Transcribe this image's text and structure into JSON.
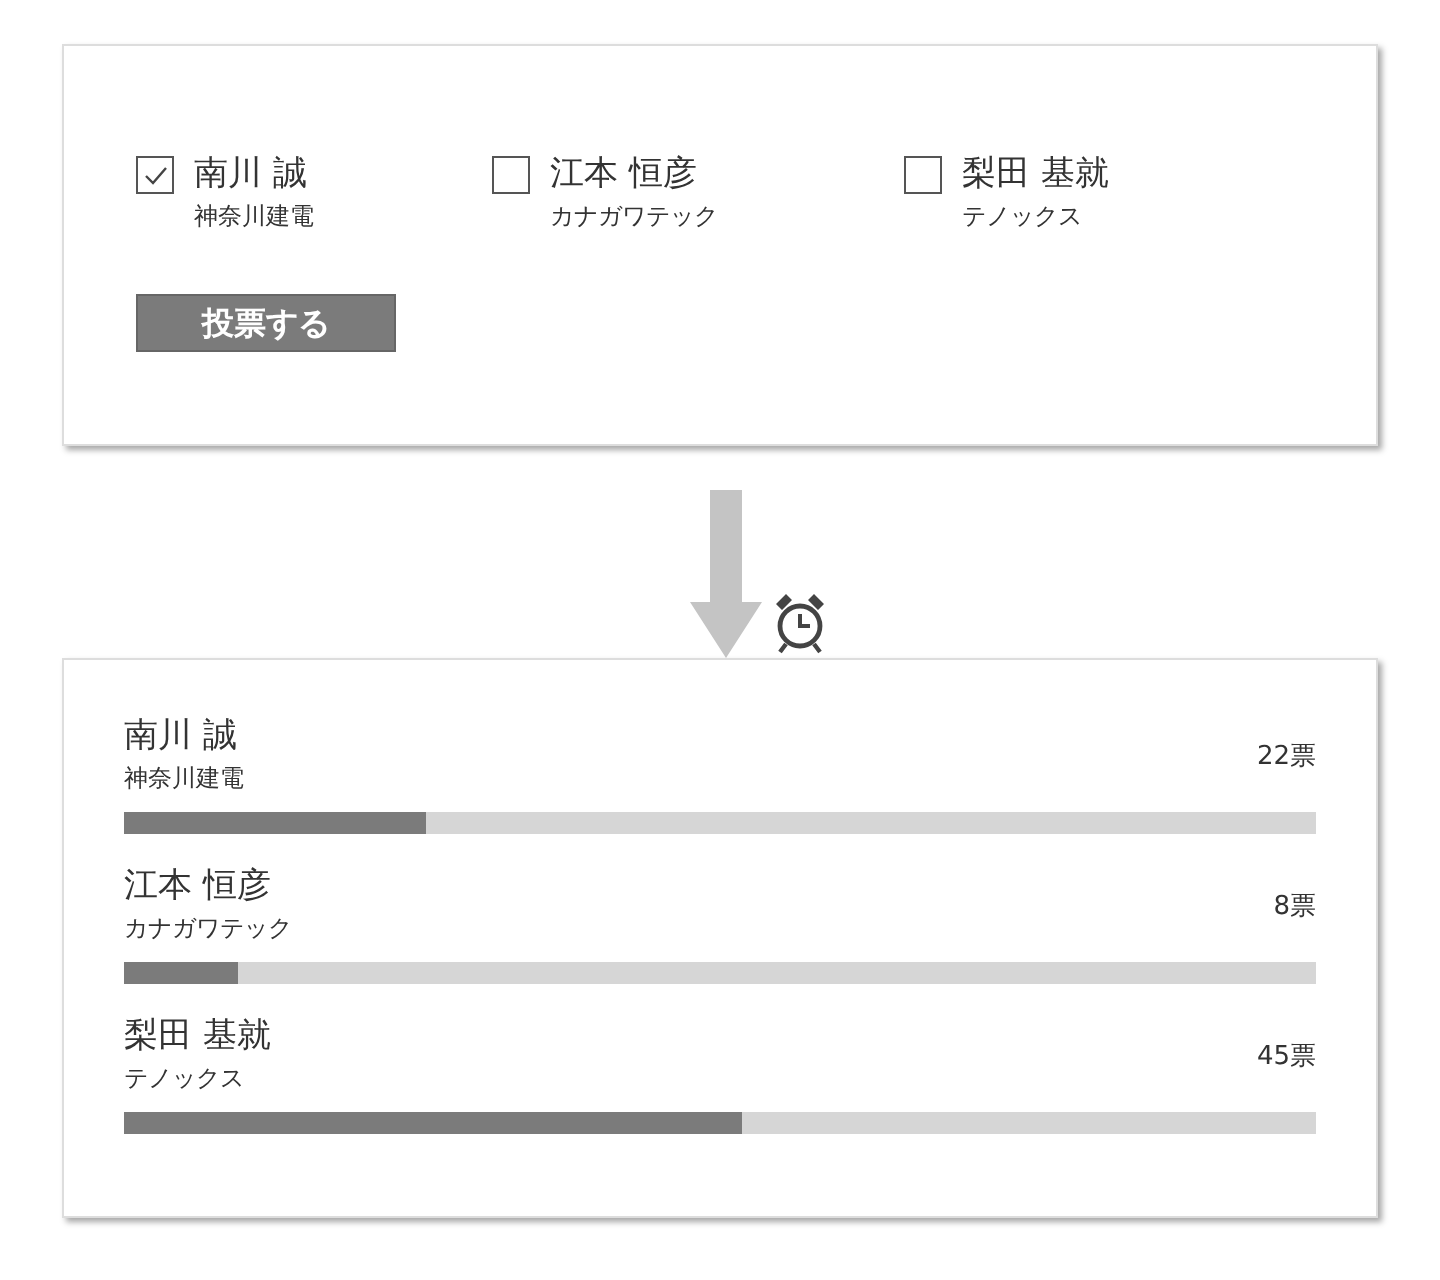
{
  "ballot": {
    "candidates": [
      {
        "name": "南川 誠",
        "company": "神奈川建電",
        "checked": true
      },
      {
        "name": "江本 恒彦",
        "company": "カナガワテック",
        "checked": false
      },
      {
        "name": "梨田 基就",
        "company": "テノックス",
        "checked": false
      }
    ],
    "button": "投票する"
  },
  "results": [
    {
      "name": "南川 誠",
      "company": "神奈川建電",
      "votes": "22票",
      "level": 0.253
    },
    {
      "name": "江本 恒彦",
      "company": "カナガワテック",
      "votes": "8票",
      "level": 0.095
    },
    {
      "name": "梨田 基就",
      "company": "テノックス",
      "votes": "45票",
      "level": 0.518
    }
  ]
}
